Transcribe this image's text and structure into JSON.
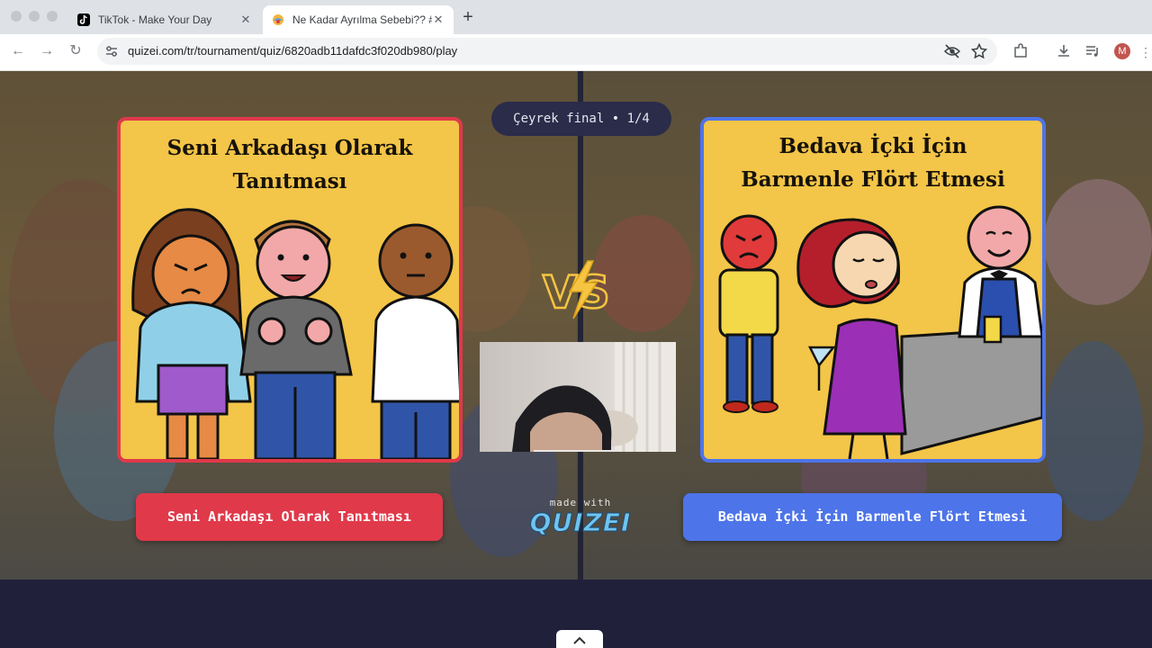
{
  "browser": {
    "tabs": [
      {
        "title": "TikTok - Make Your Day",
        "active": false,
        "icon": "tiktok-icon"
      },
      {
        "title": "Ne Kadar Ayrılma Sebebi?? #",
        "active": true,
        "icon": "quizei-favicon"
      }
    ],
    "url": "quizei.com/tr/tournament/quiz/6820adb11dafdc3f020db980/play",
    "profile_initial": "M"
  },
  "quiz": {
    "round_label": "Çeyrek final • 1/4",
    "left_option": {
      "image_title_lines": [
        "Seni Arkadaşı Olarak",
        "Tanıtması"
      ],
      "button_label": "Seni Arkadaşı Olarak Tanıtması",
      "color": "#e0394a"
    },
    "right_option": {
      "image_title_lines": [
        "Bedava İçki İçin",
        "Barmenle Flört Etmesi"
      ],
      "button_label": "Bedava İçki İçin Barmenle Flört Etmesi",
      "color": "#4d74e9"
    },
    "vs_icon": "vs-lightning-icon"
  },
  "footer": {
    "made_with": "made with",
    "brand": "QUIZEI",
    "scroll_icon": "chevron-up-icon"
  }
}
